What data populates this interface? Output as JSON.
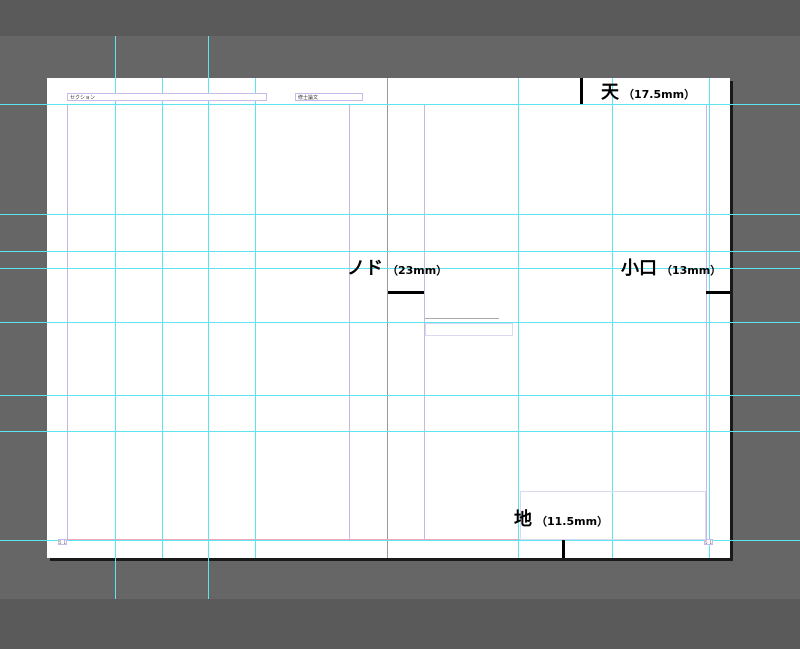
{
  "left_page": {
    "section_frame_label": "セクション",
    "title_frame_label": "修士論文",
    "nombre_left": "5_1"
  },
  "right_page": {
    "nombre_right": "5_1"
  },
  "annotations": {
    "top": {
      "label": "天",
      "value": "（17.5mm）"
    },
    "gutter": {
      "label": "ノド",
      "value": "（23mm）"
    },
    "fore_edge": {
      "label": "小口",
      "value": "（13mm）"
    },
    "bottom": {
      "label": "地",
      "value": "（11.5mm）"
    }
  },
  "colors": {
    "pasteboard": "#5a5a5a",
    "guide": "#5fe3ee",
    "margin": "#c8b6e8",
    "bleed": "#f2a6b8",
    "page": "#ffffff"
  }
}
